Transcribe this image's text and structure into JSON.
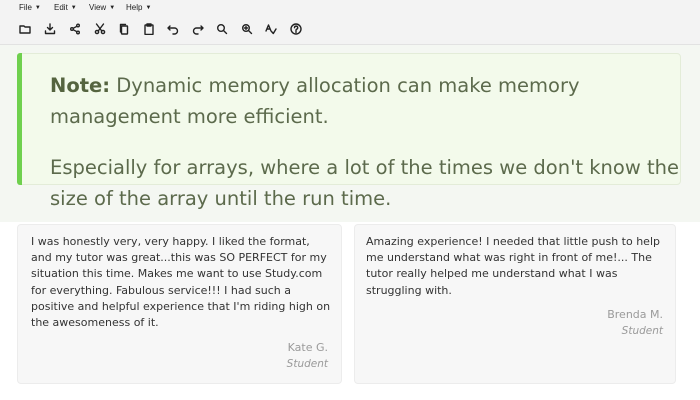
{
  "menu": {
    "file": "File",
    "edit": "Edit",
    "view": "View",
    "help": "Help"
  },
  "toolbar": {
    "icons": [
      "open-icon",
      "download-icon",
      "share-icon",
      "cut-icon",
      "copy-icon",
      "paste-icon",
      "undo-icon",
      "redo-icon",
      "zoom-in-icon",
      "zoom-out-icon",
      "spellcheck-icon",
      "help-icon"
    ]
  },
  "note": {
    "label": "Note:",
    "line1": " Dynamic memory allocation can make memory management more efficient.",
    "line2": "Especially for arrays, where a lot of the times we don't know the size of the array until the run time.",
    "accent_color": "#6fd04e"
  },
  "reviews": [
    {
      "text": "I was honestly very, very happy. I liked the format, and my tutor was great...this was SO PERFECT for my situation this time. Makes me want to use Study.com for everything. Fabulous service!!! I had such a positive and helpful experience that I'm riding high on the awesomeness of it.",
      "name": "Kate G.",
      "role": "Student"
    },
    {
      "text": "Amazing experience! I needed that little push to help me understand what was right in front of me!... The tutor really helped me understand what I was struggling with.",
      "name": "Brenda M.",
      "role": "Student"
    }
  ]
}
